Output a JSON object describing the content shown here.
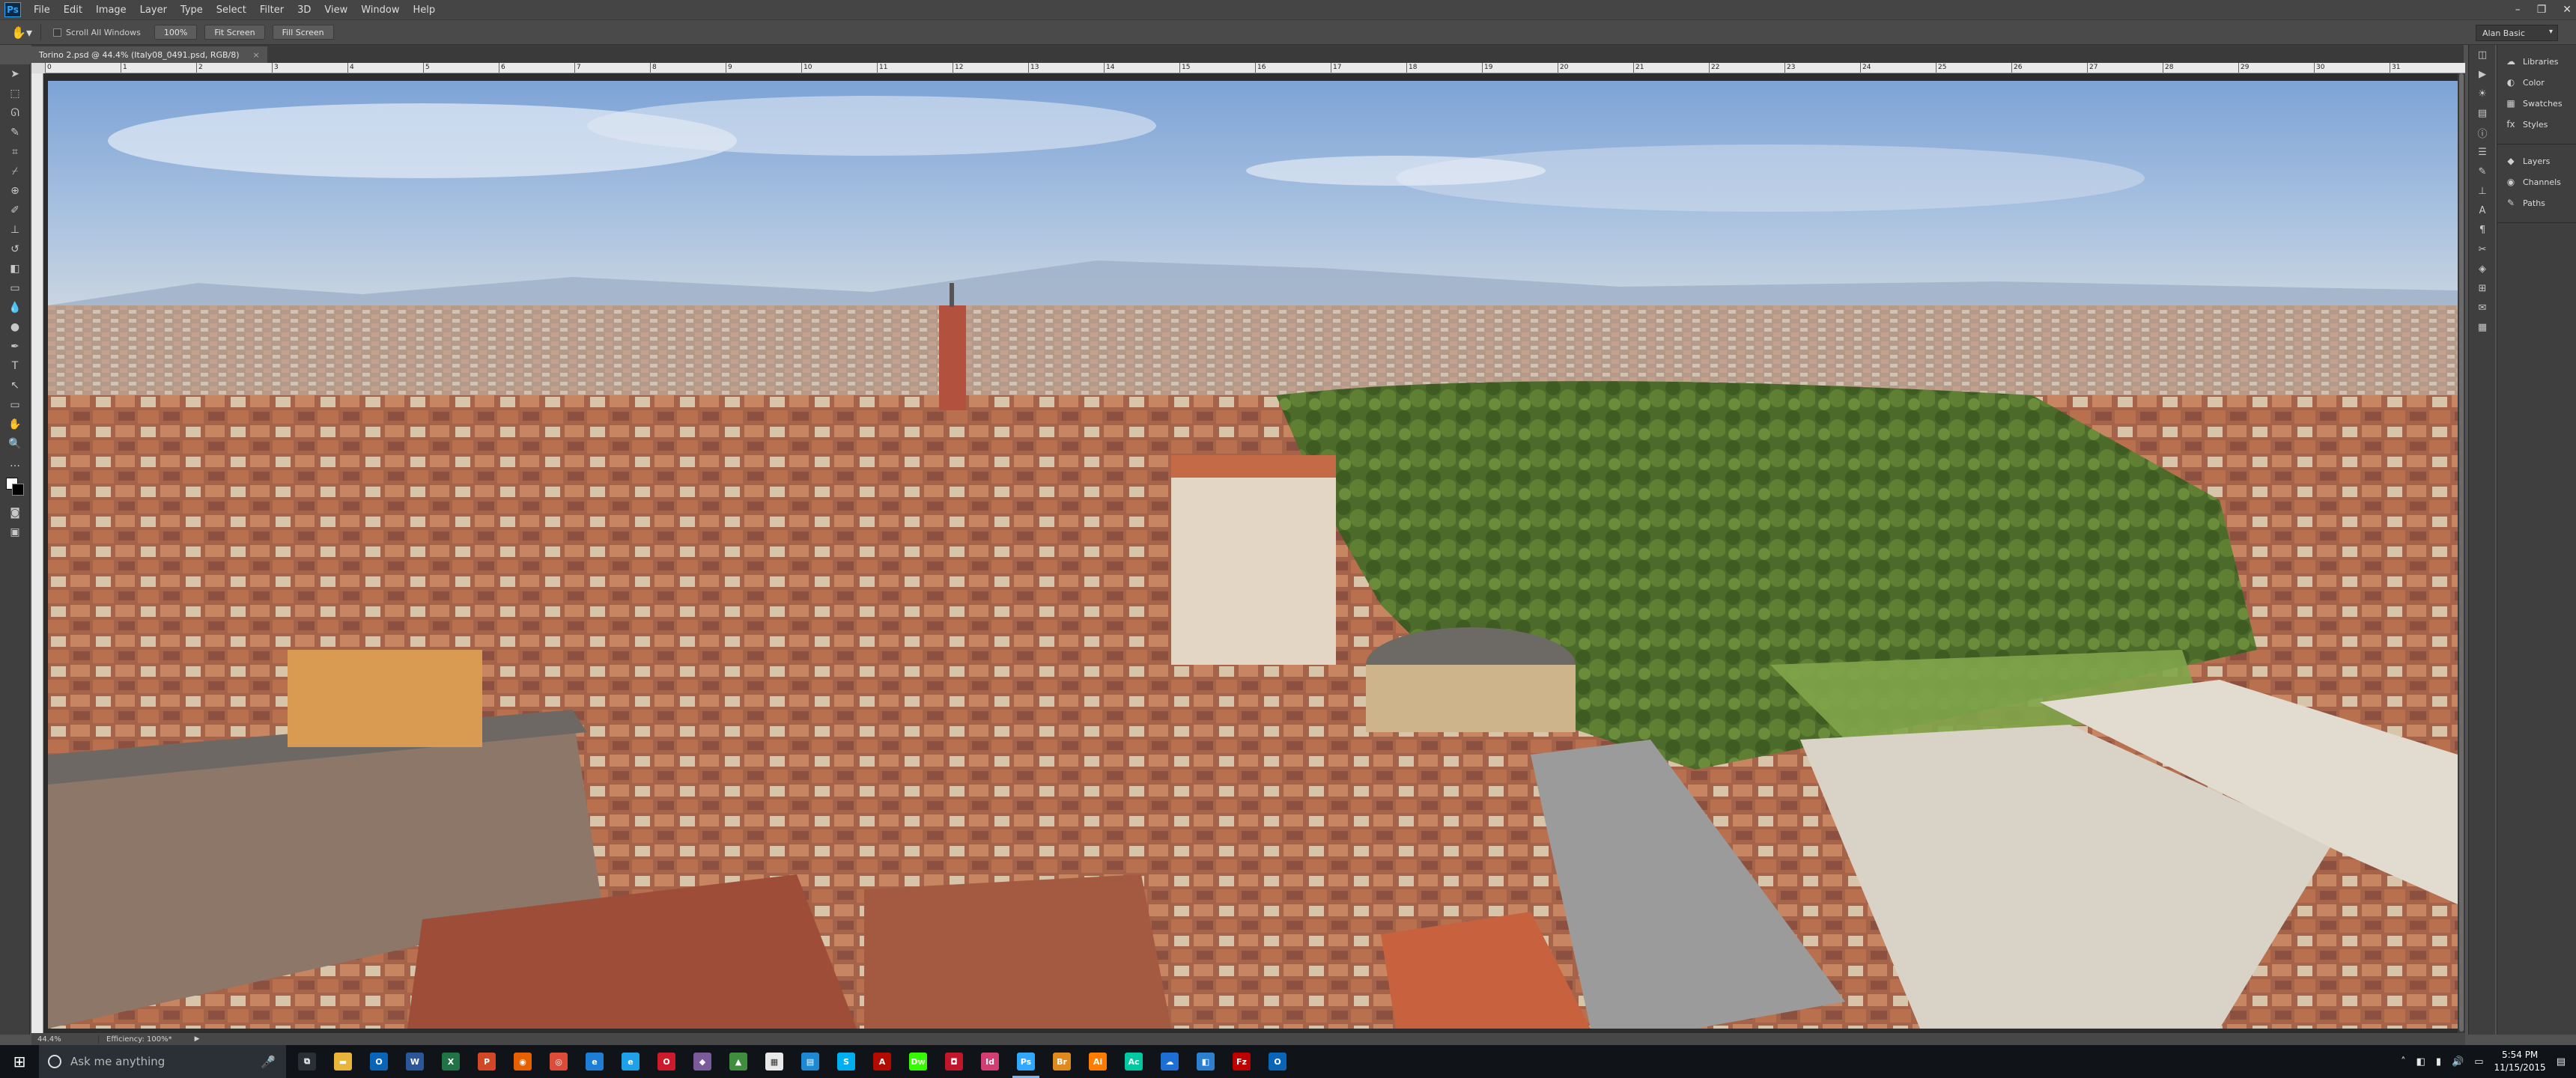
{
  "menubar": {
    "logo": "Ps",
    "items": [
      "File",
      "Edit",
      "Image",
      "Layer",
      "Type",
      "Select",
      "Filter",
      "3D",
      "View",
      "Window",
      "Help"
    ]
  },
  "options": {
    "scroll_all_windows": "Scroll All Windows",
    "btn_100": "100%",
    "btn_fit": "Fit Screen",
    "btn_fill": "Fill Screen",
    "workspace": "Alan Basic"
  },
  "document": {
    "tab_title": "Torino 2.psd @ 44.4% (Italy08_0491.psd, RGB/8)",
    "close": "×"
  },
  "ruler": {
    "top_ticks": [
      "0",
      "1",
      "2",
      "3",
      "4",
      "5",
      "6",
      "7",
      "8",
      "9",
      "10",
      "11",
      "12",
      "13",
      "14",
      "15",
      "16",
      "17",
      "18",
      "19",
      "20",
      "21",
      "22",
      "23",
      "24",
      "25",
      "26",
      "27",
      "28",
      "29",
      "30",
      "31"
    ]
  },
  "status": {
    "zoom": "44.4%",
    "info": "Efficiency: 100%*"
  },
  "panels": {
    "group1": [
      "Libraries",
      "Color",
      "Swatches",
      "Styles"
    ],
    "group2": [
      "Layers",
      "Channels",
      "Paths"
    ]
  },
  "taskbar": {
    "search_placeholder": "Ask me anything",
    "time": "5:54 PM",
    "date": "11/15/2015",
    "apps": [
      {
        "name": "task-view",
        "label": "⧉",
        "color": "#2a2f36"
      },
      {
        "name": "file-explorer",
        "label": "▬",
        "color": "#e8b53a"
      },
      {
        "name": "outlook",
        "label": "O",
        "color": "#0a64b8"
      },
      {
        "name": "word",
        "label": "W",
        "color": "#2b579a"
      },
      {
        "name": "excel",
        "label": "X",
        "color": "#217346"
      },
      {
        "name": "powerpoint",
        "label": "P",
        "color": "#d24726"
      },
      {
        "name": "firefox",
        "label": "◉",
        "color": "#e66000"
      },
      {
        "name": "chrome",
        "label": "◎",
        "color": "#dd4b39"
      },
      {
        "name": "edge",
        "label": "e",
        "color": "#1e7ed6"
      },
      {
        "name": "ie",
        "label": "e",
        "color": "#1ea1e8"
      },
      {
        "name": "opera",
        "label": "O",
        "color": "#cc1b2b"
      },
      {
        "name": "app-misc1",
        "label": "◆",
        "color": "#7a5a9a"
      },
      {
        "name": "app-misc2",
        "label": "▲",
        "color": "#3e8e3e"
      },
      {
        "name": "app-misc3",
        "label": "▦",
        "color": "#e9e9e9"
      },
      {
        "name": "store",
        "label": "▤",
        "color": "#1e88d4"
      },
      {
        "name": "skype",
        "label": "S",
        "color": "#00aff0"
      },
      {
        "name": "acrobat",
        "label": "A",
        "color": "#b30b00"
      },
      {
        "name": "dreamweaver",
        "label": "Dw",
        "color": "#35fa00"
      },
      {
        "name": "app-red",
        "label": "◘",
        "color": "#c0182a"
      },
      {
        "name": "indesign",
        "label": "Id",
        "color": "#d33e72"
      },
      {
        "name": "photoshop",
        "label": "Ps",
        "color": "#31a8ff",
        "active": true
      },
      {
        "name": "bridge",
        "label": "Br",
        "color": "#e08a1e"
      },
      {
        "name": "illustrator",
        "label": "Ai",
        "color": "#ff7c00"
      },
      {
        "name": "audition",
        "label": "Ac",
        "color": "#00c8a0"
      },
      {
        "name": "onedrive",
        "label": "☁",
        "color": "#1e6fd4"
      },
      {
        "name": "app-blue",
        "label": "◧",
        "color": "#2d7fd0"
      },
      {
        "name": "filezilla",
        "label": "Fz",
        "color": "#bf0000"
      },
      {
        "name": "outlook2",
        "label": "O",
        "color": "#0a64b8"
      }
    ]
  }
}
